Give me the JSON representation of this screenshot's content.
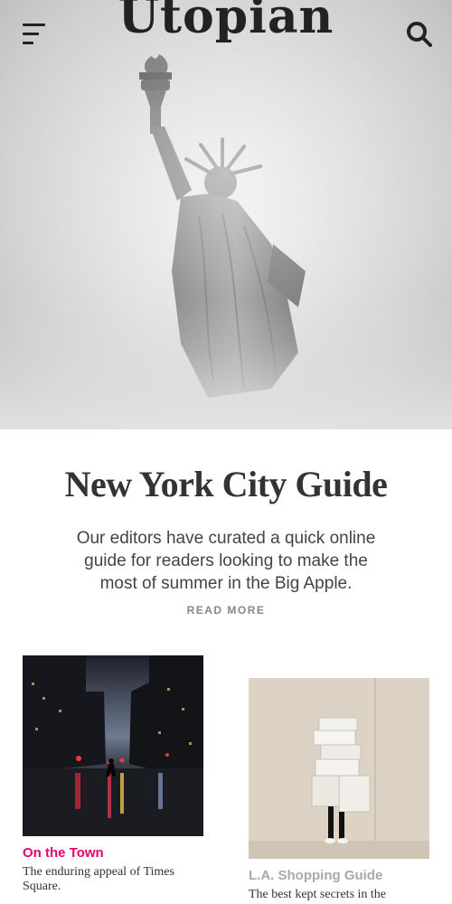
{
  "header": {
    "logo": "Utopian",
    "menu_icon": "hamburger-menu-icon",
    "search_icon": "search-icon"
  },
  "feature": {
    "title": "New York City Guide",
    "description": "Our editors have curated a quick online guide for readers looking to make the most of summer in the Big Apple.",
    "read_more": "READ MORE"
  },
  "cards": [
    {
      "title": "On the Town",
      "description": "The enduring appeal of Times Square.",
      "title_color": "#e5006e"
    },
    {
      "title": "L.A. Shopping Guide",
      "description": "The best kept secrets in the",
      "title_color": "#a8a8a8"
    }
  ]
}
